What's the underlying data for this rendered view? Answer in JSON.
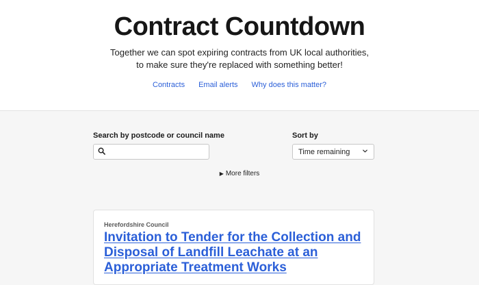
{
  "header": {
    "title": "Contract Countdown",
    "tagline": "Together we can spot expiring contracts from UK local authorities, to make sure they're replaced with something better!",
    "nav": [
      {
        "label": "Contracts"
      },
      {
        "label": "Email alerts"
      },
      {
        "label": "Why does this matter?"
      }
    ]
  },
  "search": {
    "label": "Search by postcode or council name",
    "value": "",
    "icon": "search-icon"
  },
  "sort": {
    "label": "Sort by",
    "selected": "Time remaining",
    "icon": "chevron-down-icon"
  },
  "filters": {
    "label": "More filters"
  },
  "contracts": [
    {
      "organisation": "Herefordshire Council",
      "title": "Invitation to Tender for the Collection and Disposal of Landfill Leachate at an Appropriate Treatment Works"
    }
  ],
  "colors": {
    "link": "#2b5fd8",
    "background": "#f6f6f6"
  }
}
